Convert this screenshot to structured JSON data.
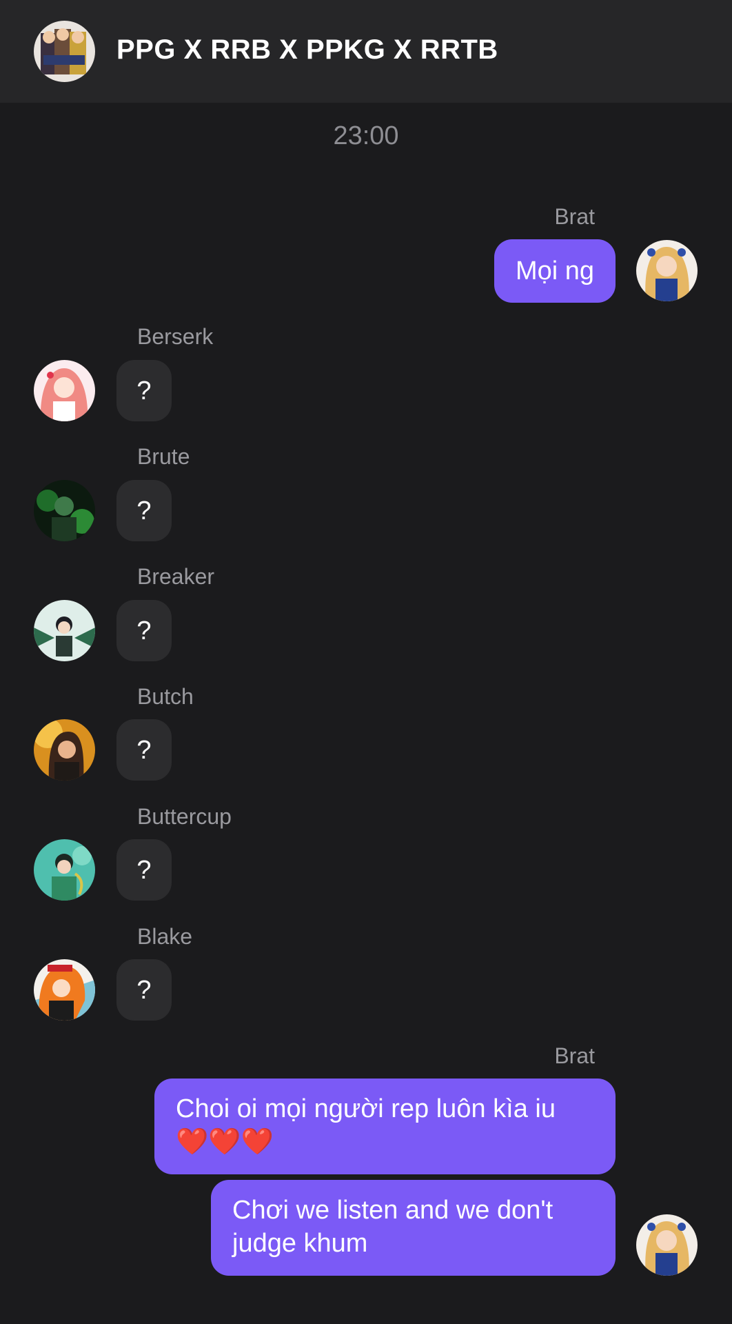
{
  "header": {
    "title": "PPG X RRB X PPKG X RRTB"
  },
  "timestamp": "23:00",
  "messages": [
    {
      "sender": "Brat",
      "text": "Mọi ng",
      "direction": "outgoing"
    },
    {
      "sender": "Berserk",
      "text": "?",
      "direction": "incoming"
    },
    {
      "sender": "Brute",
      "text": "?",
      "direction": "incoming"
    },
    {
      "sender": "Breaker",
      "text": "?",
      "direction": "incoming"
    },
    {
      "sender": "Butch",
      "text": "?",
      "direction": "incoming"
    },
    {
      "sender": "Buttercup",
      "text": "?",
      "direction": "incoming"
    },
    {
      "sender": "Blake",
      "text": "?",
      "direction": "incoming"
    },
    {
      "sender": "Brat",
      "text": "Choi oi mọi người rep luôn kìa iu",
      "emoji": "❤️❤️❤️",
      "direction": "outgoing"
    },
    {
      "text_line1": "Chơi we listen and we don't",
      "text_line2": "judge khum",
      "direction": "outgoing"
    }
  ],
  "colors": {
    "background": "#1b1b1d",
    "header": "#262628",
    "incoming_bubble": "#2c2c2e",
    "outgoing_bubble": "#7b5af6",
    "sender_name": "#9a9a9f",
    "timestamp": "#8e8e93"
  }
}
